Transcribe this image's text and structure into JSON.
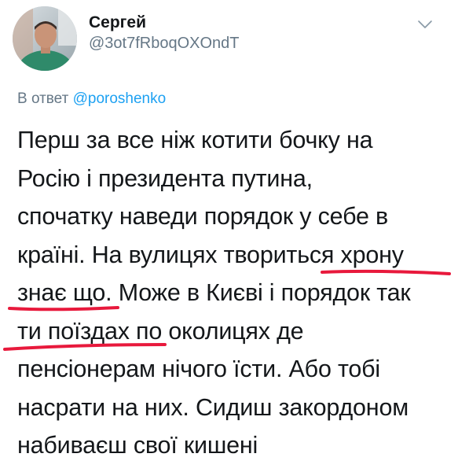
{
  "author": {
    "display_name": "Сергей",
    "handle": "@3ot7fRboqOXOndT"
  },
  "reply": {
    "prefix": "В ответ",
    "mention": "@poroshenko"
  },
  "tweet": {
    "lines": [
      "Перш за все ніж котити бочку на",
      "Росію і президента путина,",
      "спочатку наведи порядок у себе в",
      "країні. На вулицях твориться хрону",
      "знає що. Може в Києві і порядок так",
      "ти поїздах по околицях де",
      "пенсіонерам нічого їсти. Або тобі",
      "насрати на них. Сидиш закордоном",
      "набиваєш свої кишені"
    ]
  },
  "icons": {
    "menu": "chevron-down-icon"
  },
  "colors": {
    "text": "#14171a",
    "secondary": "#657786",
    "link": "#1da1f2",
    "underline": "#e8193c"
  }
}
